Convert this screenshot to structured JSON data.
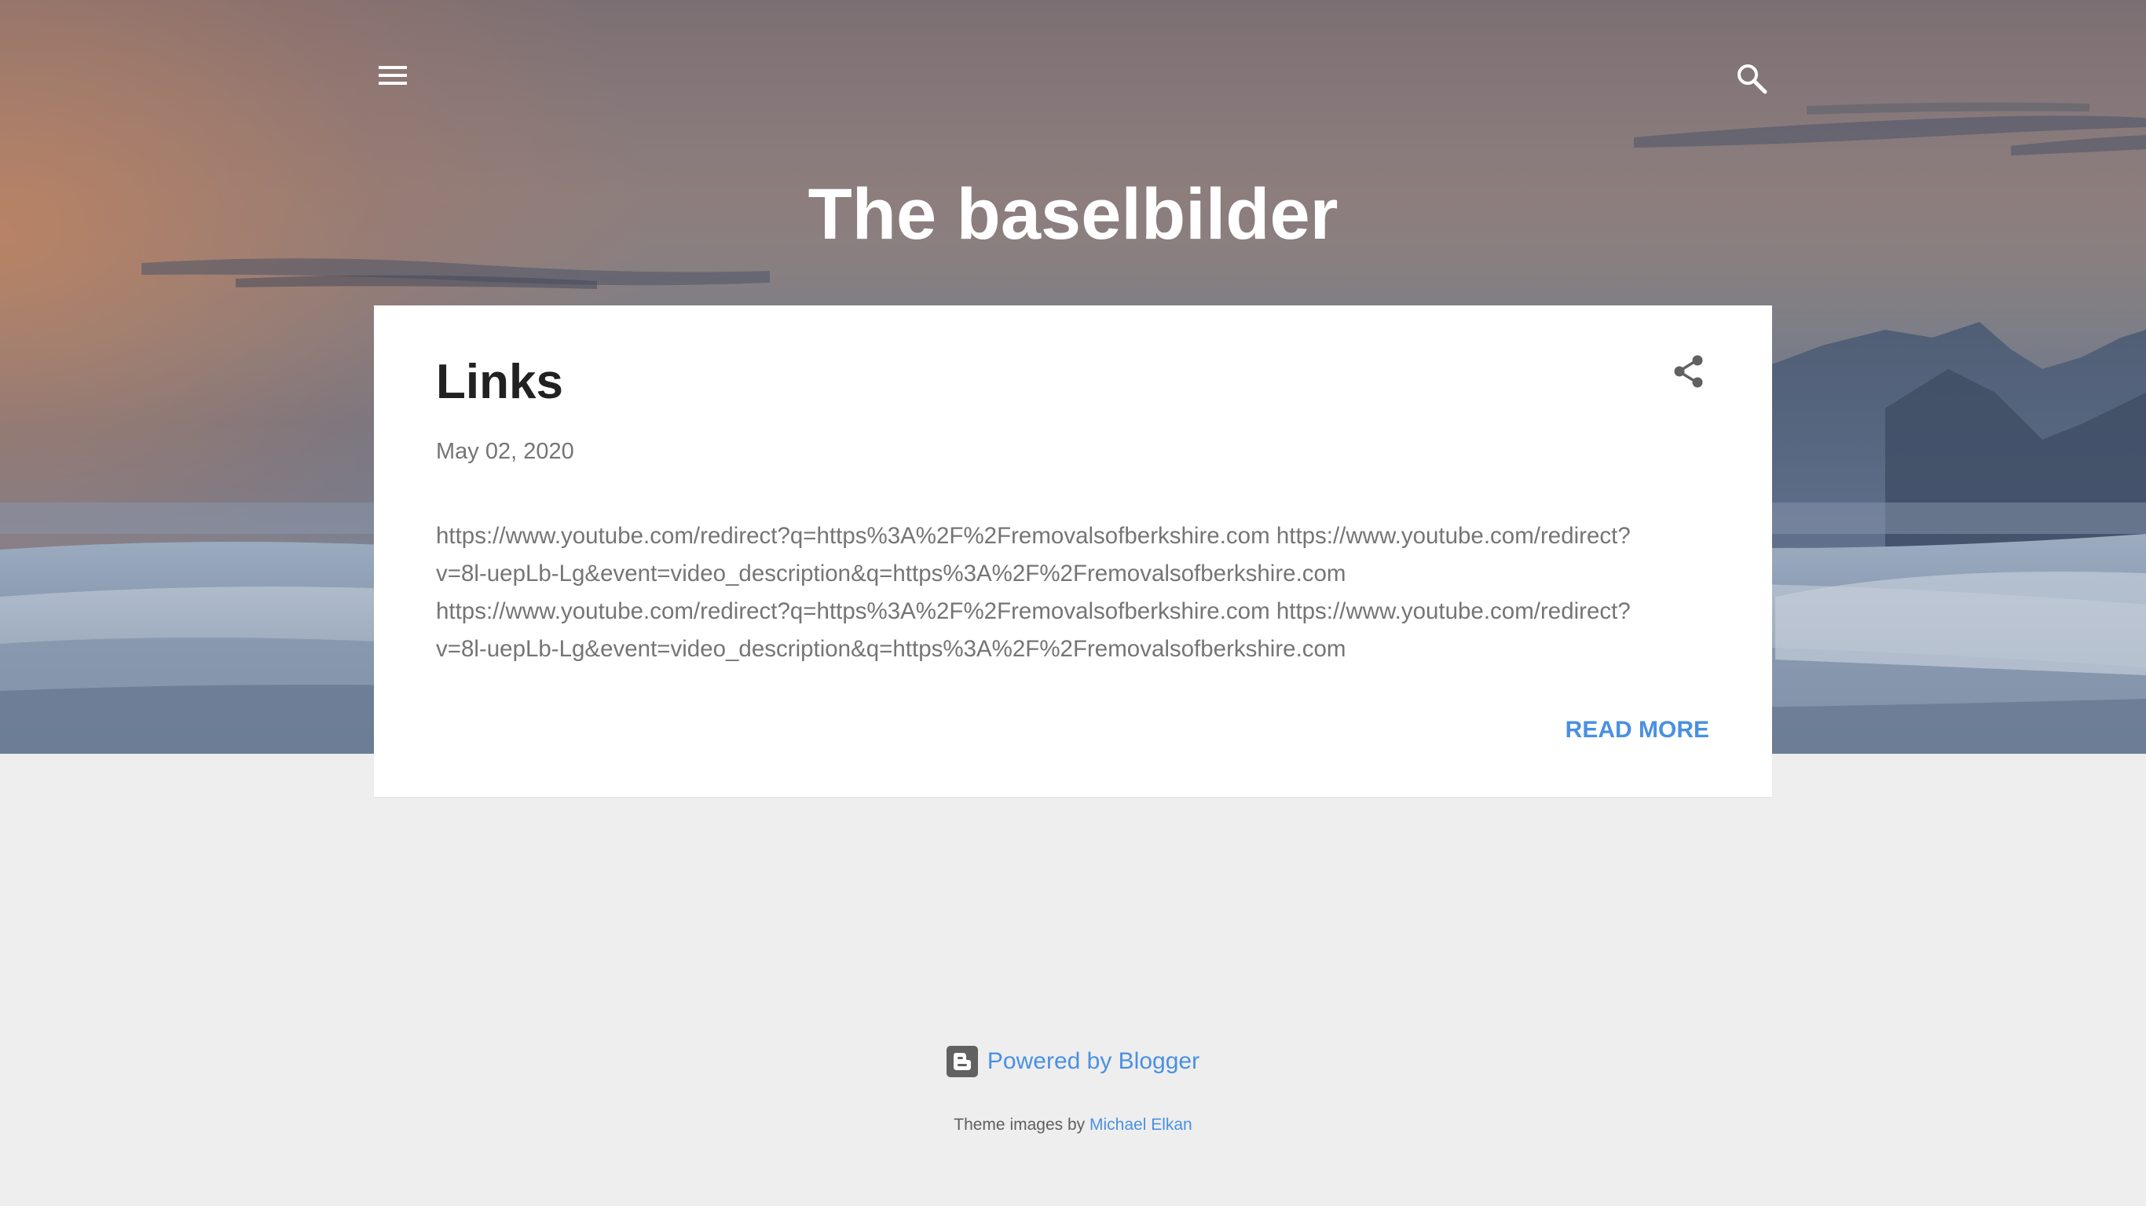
{
  "header": {
    "title": "The baselbilder",
    "menu_icon": "hamburger-menu-icon",
    "search_icon": "search-icon"
  },
  "post": {
    "title": "Links",
    "date": "May 02, 2020",
    "snippet_lines": [
      "https://www.youtube.com/redirect?q=https%3A%2F%2Fremovalsofberkshire.com https://www.youtube.com/redirect?",
      "v=8l-uepLb-Lg&event=video_description&q=https%3A%2F%2Fremovalsofberkshire.com",
      "https://www.youtube.com/redirect?q=https%3A%2F%2Fremovalsofberkshire.com https://www.youtube.com/redirect?",
      "v=8l-uepLb-Lg&event=video_description&q=https%3A%2F%2Fremovalsofberkshire.com"
    ],
    "read_more": "READ MORE",
    "share_icon": "share-icon"
  },
  "footer": {
    "powered_by": "Powered by Blogger",
    "blogger_icon": "blogger-logo-icon",
    "attribution_prefix": "Theme images by",
    "attribution_name": "Michael Elkan"
  },
  "colors": {
    "page_background": "#eeeeee",
    "card_background": "#ffffff",
    "title_text": "#212121",
    "body_text": "#757575",
    "link_accent": "#4a90e2",
    "header_text": "#ffffff"
  }
}
